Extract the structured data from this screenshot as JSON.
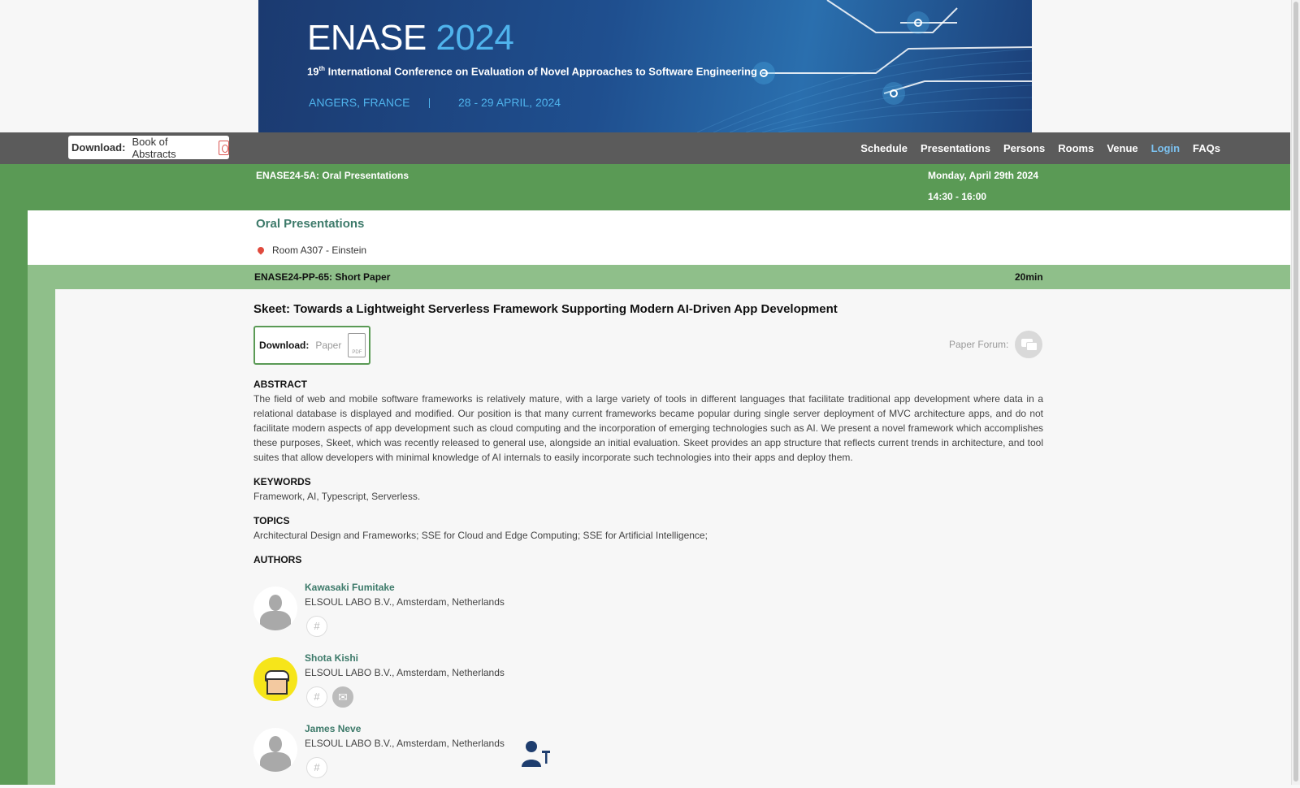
{
  "banner": {
    "title_main": "ENASE",
    "title_year": "2024",
    "sub_sup": "th",
    "sub_num": "19",
    "subtitle": "International Conference on Evaluation of Novel Approaches to Software Engineering",
    "location": "ANGERS, FRANCE",
    "separator": "|",
    "dates": "28 - 29 APRIL, 2024"
  },
  "navbar": {
    "download_label": "Download:",
    "download_value": "Book of Abstracts",
    "links": [
      "Schedule",
      "Presentations",
      "Persons",
      "Rooms",
      "Venue",
      "Login",
      "FAQs"
    ]
  },
  "session": {
    "code": "ENASE24-5A: Oral Presentations",
    "date": "Monday, April 29th 2024",
    "time": "14:30 - 16:00",
    "name": "Oral Presentations",
    "room": "Room A307 - Einstein"
  },
  "paper": {
    "code": "ENASE24-PP-65: Short Paper",
    "duration": "20min",
    "title": "Skeet: Towards a Lightweight Serverless Framework Supporting Modern AI-Driven App Development",
    "download_label": "Download:",
    "download_value": "Paper",
    "pdf_text": "PDF",
    "forum_label": "Paper Forum:",
    "abstract_heading": "ABSTRACT",
    "abstract": "The field of web and mobile software frameworks is relatively mature, with a large variety of tools in different languages that facilitate traditional app development where data in a relational database is displayed and modified. Our position is that many current frameworks became popular during single server deployment of MVC architecture apps, and do not facilitate modern aspects of app development such as cloud computing and the incorporation of emerging technologies such as AI. We present a novel framework which accomplishes these purposes, Skeet, which was recently released to general use, alongside an initial evaluation. Skeet provides an app structure that reflects current trends in architecture, and tool suites that allow developers with minimal knowledge of AI internals to easily incorporate such technologies into their apps and deploy them.",
    "keywords_heading": "KEYWORDS",
    "keywords": "Framework, AI, Typescript, Serverless.",
    "topics_heading": "TOPICS",
    "topics": "Architectural Design and Frameworks; SSE for Cloud and Edge Computing; SSE for Artificial Intelligence;",
    "authors_heading": "AUTHORS"
  },
  "authors": [
    {
      "name": "Kawasaki Fumitake",
      "affiliation": "ELSOUL LABO B.V., Amsterdam, Netherlands"
    },
    {
      "name": "Shota Kishi",
      "affiliation": "ELSOUL LABO B.V., Amsterdam, Netherlands"
    },
    {
      "name": "James Neve",
      "affiliation": "ELSOUL LABO B.V., Amsterdam, Netherlands"
    }
  ],
  "icons": {
    "hash": "#",
    "mail": "✉"
  },
  "colors": {
    "session_green": "#5a9a55",
    "paper_green": "#8fbf8a",
    "link_teal": "#3d7a6a",
    "nav_active": "#7cc1ef"
  }
}
